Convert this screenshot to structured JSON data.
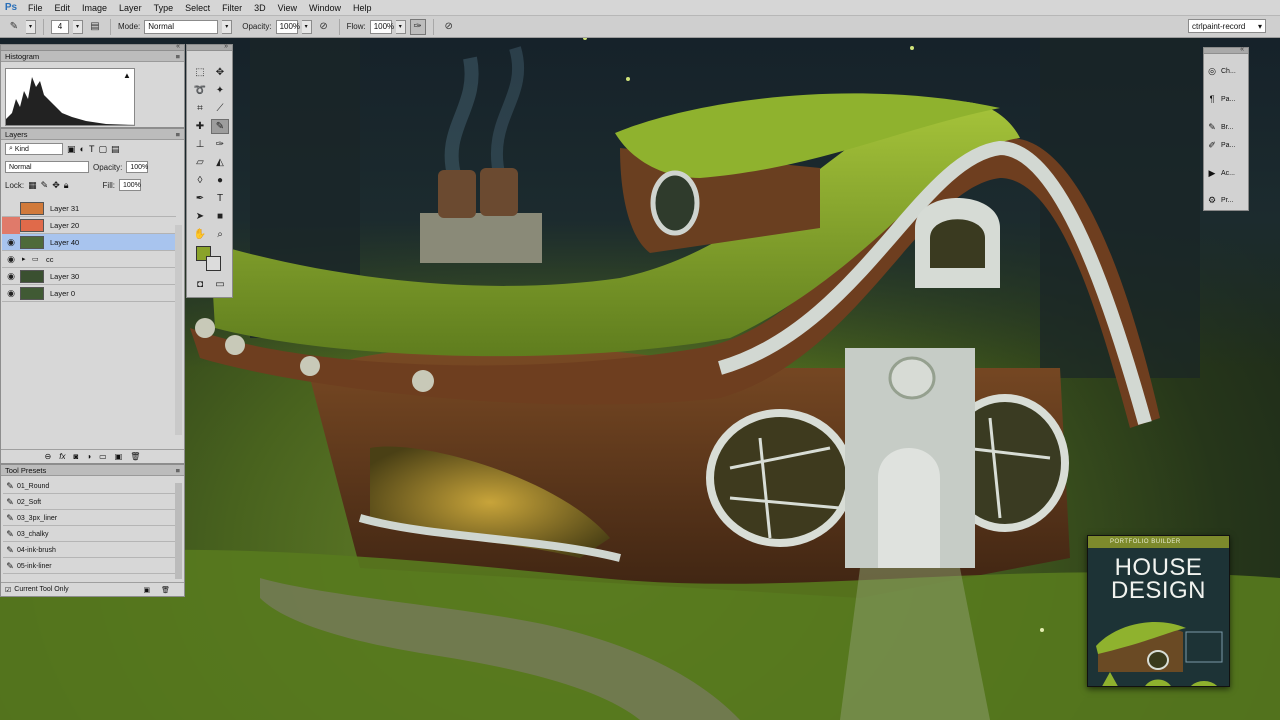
{
  "app": {
    "logo": "Ps"
  },
  "menu": [
    "File",
    "Edit",
    "Image",
    "Layer",
    "Type",
    "Select",
    "Filter",
    "3D",
    "View",
    "Window",
    "Help"
  ],
  "options": {
    "brush_size": "4",
    "mode_label": "Mode:",
    "mode_value": "Normal",
    "opacity_label": "Opacity:",
    "opacity_value": "100%",
    "flow_label": "Flow:",
    "flow_value": "100%",
    "workspace": "ctrlpaint-record"
  },
  "histogram": {
    "title": "Histogram"
  },
  "layers": {
    "title": "Layers",
    "filter": "Kind",
    "blend_mode": "Normal",
    "opacity_label": "Opacity:",
    "opacity_value": "100%",
    "lock_label": "Lock:",
    "fill_label": "Fill:",
    "fill_value": "100%",
    "items": [
      {
        "name": "Layer 31",
        "visible": false
      },
      {
        "name": "Layer 20",
        "visible": false
      },
      {
        "name": "Layer 40",
        "visible": true,
        "selected": true
      },
      {
        "name": "cc",
        "visible": true,
        "group": true
      },
      {
        "name": "Layer 30",
        "visible": true
      },
      {
        "name": "Layer 0",
        "visible": true
      }
    ],
    "footer_icons": [
      "link-icon",
      "fx-icon",
      "mask-icon",
      "adjustment-icon",
      "group-icon",
      "new-layer-icon",
      "trash-icon"
    ]
  },
  "tool_presets": {
    "title": "Tool Presets",
    "items": [
      "01_Round",
      "02_Soft",
      "03_3px_liner",
      "03_chalky",
      "04-ink-brush",
      "05-ink-liner"
    ],
    "current_only": "Current Tool Only"
  },
  "right_dock": {
    "items": [
      "Ch...",
      "Pa...",
      "Br...",
      "Pa...",
      "Ac...",
      "Pr..."
    ]
  },
  "colors": {
    "foreground": "#8aa32a",
    "background": "#dcdcdc",
    "selection": "#a8c4ee"
  },
  "book": {
    "band": "PORTFOLIO BUILDER",
    "title_line1": "HOUSE",
    "title_line2": "DESIGN"
  }
}
